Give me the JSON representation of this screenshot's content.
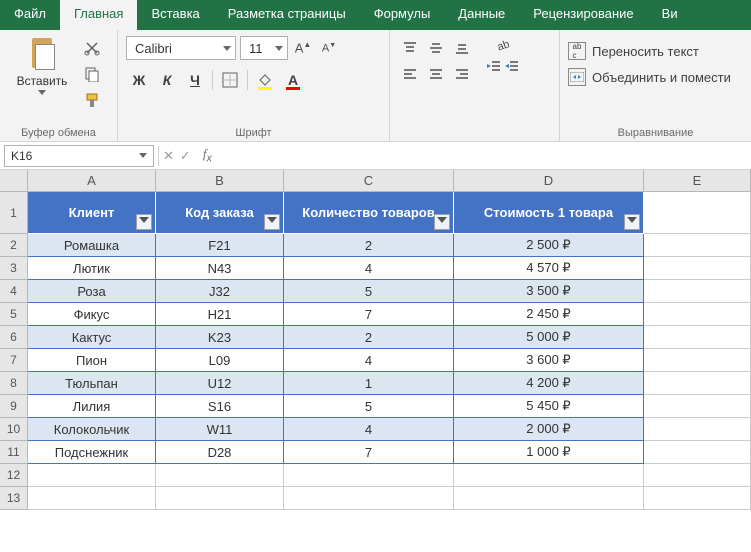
{
  "tabs": [
    "Файл",
    "Главная",
    "Вставка",
    "Разметка страницы",
    "Формулы",
    "Данные",
    "Рецензирование",
    "Ви"
  ],
  "active_tab": 1,
  "ribbon": {
    "clipboard": {
      "paste": "Вставить",
      "group": "Буфер обмена"
    },
    "font": {
      "name": "Calibri",
      "size": "11",
      "group": "Шрифт",
      "bold": "Ж",
      "italic": "К",
      "underline": "Ч"
    },
    "align": {
      "group": "Выравнивание",
      "wrap": "Переносить текст",
      "merge": "Объединить и помести"
    }
  },
  "name_box": "K16",
  "formula": "",
  "chart_data": {
    "type": "table",
    "columns": [
      "Клиент",
      "Код заказа",
      "Количество товаров",
      "Стоимость 1 товара"
    ],
    "rows": [
      [
        "Ромашка",
        "F21",
        "2",
        "2 500 ₽"
      ],
      [
        "Лютик",
        "N43",
        "4",
        "4 570 ₽"
      ],
      [
        "Роза",
        "J32",
        "5",
        "3 500 ₽"
      ],
      [
        "Фикус",
        "H21",
        "7",
        "2 450 ₽"
      ],
      [
        "Кактус",
        "K23",
        "2",
        "5 000 ₽"
      ],
      [
        "Пион",
        "L09",
        "4",
        "3 600 ₽"
      ],
      [
        "Тюльпан",
        "U12",
        "1",
        "4 200 ₽"
      ],
      [
        "Лилия",
        "S16",
        "5",
        "5 450 ₽"
      ],
      [
        "Колокольчик",
        "W11",
        "4",
        "2 000 ₽"
      ],
      [
        "Подснежник",
        "D28",
        "7",
        "1 000 ₽"
      ]
    ]
  },
  "col_letters": [
    "A",
    "B",
    "C",
    "D",
    "E"
  ],
  "row_numbers": [
    "1",
    "2",
    "3",
    "4",
    "5",
    "6",
    "7",
    "8",
    "9",
    "10",
    "11",
    "12",
    "13"
  ]
}
